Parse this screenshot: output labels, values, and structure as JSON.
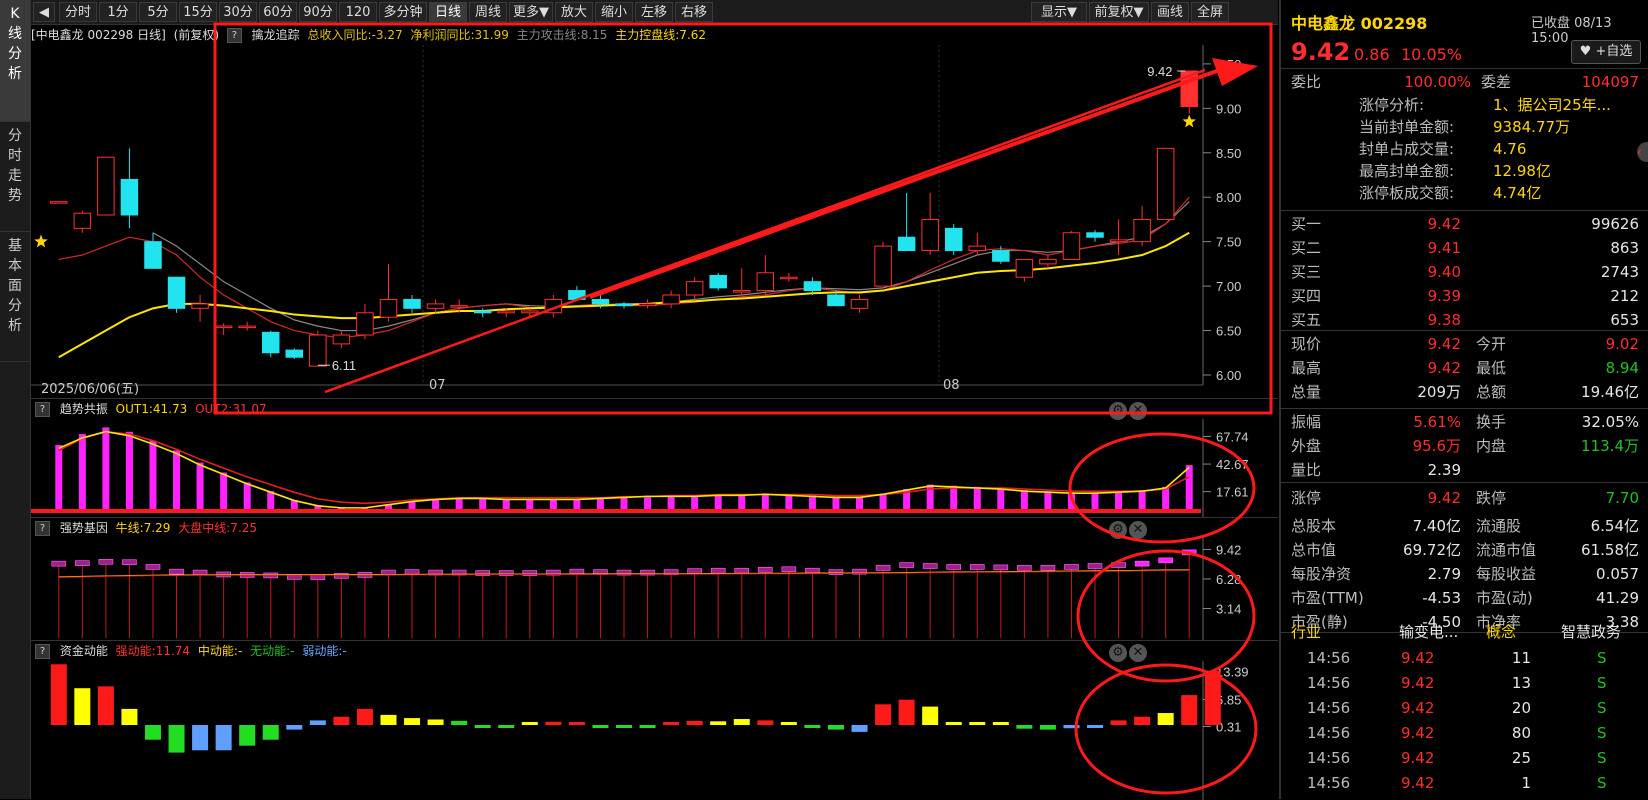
{
  "left_tabs": [
    "K线分析",
    "分时走势",
    "基本面分析"
  ],
  "toolbar": {
    "period_buttons": [
      "分时",
      "1分",
      "5分",
      "15分",
      "30分",
      "60分",
      "90分",
      "120分",
      "多分钟",
      "日线",
      "周线",
      "更多▼",
      "放大",
      "缩小",
      "左移",
      "右移"
    ],
    "right_buttons": [
      "显示▼",
      "前复权▼",
      "画线",
      "全屏"
    ],
    "active": "日线"
  },
  "main_panel": {
    "stock_label": "[中电鑫龙 002298 日线]",
    "fq_label": "(前复权)",
    "indicator_name": "擒龙追踪",
    "indicator_values": [
      "总收入同比:-3.27",
      "净利润同比:31.99",
      "主力攻击线:8.15",
      "主力控盘线:7.62"
    ],
    "y_ticks": [
      "9.50",
      "9.00",
      "8.50",
      "8.00",
      "7.50",
      "7.00",
      "6.50",
      "6.00"
    ],
    "date_label": "2025/06/06(五)",
    "month_labels": [
      "07",
      "08"
    ],
    "high_label": "9.42",
    "low_label": "6.11"
  },
  "panel2": {
    "name": "趋势共振",
    "out1": "OUT1:41.73",
    "out2": "OUT2:31.07",
    "y_ticks": [
      "67.74",
      "42.67",
      "17.61"
    ]
  },
  "panel3": {
    "name": "强势基因",
    "line1": "牛线:7.29",
    "line2": "大盘中线:7.25",
    "y_ticks": [
      "9.42",
      "6.28",
      "3.14"
    ]
  },
  "panel4": {
    "name": "资金动能",
    "strong": "强动能:11.74",
    "mid": "中动能:-",
    "none": "无动能:-",
    "weak": "弱动能:-",
    "y_ticks": [
      "13.39",
      "6.85",
      "0.31"
    ]
  },
  "quote": {
    "name": "中电鑫龙 002298",
    "status": "已收盘 08/13 15:00",
    "price": "9.42",
    "change": "0.86",
    "pct": "10.05%",
    "add_label": "+自选",
    "wb_label": "委比",
    "wb_value": "100.00%",
    "wc_label": "委差",
    "wc_value": "104097",
    "limit_info": [
      {
        "k": "涨停分析:",
        "v": "1、据公司25年..."
      },
      {
        "k": "当前封单金额:",
        "v": "9384.77万"
      },
      {
        "k": "封单占成交量:",
        "v": "4.76"
      },
      {
        "k": "最高封单金额:",
        "v": "12.98亿"
      },
      {
        "k": "涨停板成交额:",
        "v": "4.74亿"
      }
    ],
    "buys": [
      {
        "k": "买一",
        "p": "9.42",
        "v": "99626"
      },
      {
        "k": "买二",
        "p": "9.41",
        "v": "863"
      },
      {
        "k": "买三",
        "p": "9.40",
        "v": "2743"
      },
      {
        "k": "买四",
        "p": "9.39",
        "v": "212"
      },
      {
        "k": "买五",
        "p": "9.38",
        "v": "653"
      }
    ],
    "stats": [
      {
        "k1": "现价",
        "v1": "9.42",
        "k2": "今开",
        "v2": "9.02"
      },
      {
        "k1": "最高",
        "v1": "9.42",
        "k2": "最低",
        "v2": "8.94"
      },
      {
        "k1": "总量",
        "v1": "209万",
        "k2": "总额",
        "v2": "19.46亿"
      },
      {
        "k1": "振幅",
        "v1": "5.61%",
        "k2": "换手",
        "v2": "32.05%"
      },
      {
        "k1": "外盘",
        "v1": "95.6万",
        "k2": "内盘",
        "v2": "113.4万"
      },
      {
        "k1": "量比",
        "v1": "2.39",
        "k2": "",
        "v2": ""
      },
      {
        "k1": "涨停",
        "v1": "9.42",
        "k2": "跌停",
        "v2": "7.70"
      },
      {
        "k1": "总股本",
        "v1": "7.40亿",
        "k2": "流通股",
        "v2": "6.54亿"
      },
      {
        "k1": "总市值",
        "v1": "69.72亿",
        "k2": "流通市值",
        "v2": "61.58亿"
      },
      {
        "k1": "每股净资",
        "v1": "2.79",
        "k2": "每股收益",
        "v2": "0.057"
      },
      {
        "k1": "市盈(TTM)",
        "v1": "-4.53",
        "k2": "市盈(动)",
        "v2": "41.29"
      },
      {
        "k1": "市盈(静)",
        "v1": "-4.50",
        "k2": "市净率",
        "v2": "3.38"
      }
    ],
    "industry": {
      "k1": "行业",
      "v1": "输变电...",
      "k2": "概念",
      "v2": "智慧政务"
    },
    "ticks": [
      {
        "t": "14:56",
        "p": "9.42",
        "v": "11",
        "s": "S"
      },
      {
        "t": "14:56",
        "p": "9.42",
        "v": "13",
        "s": "S"
      },
      {
        "t": "14:56",
        "p": "9.42",
        "v": "20",
        "s": "S"
      },
      {
        "t": "14:56",
        "p": "9.42",
        "v": "80",
        "s": "S"
      },
      {
        "t": "14:56",
        "p": "9.42",
        "v": "25",
        "s": "S"
      },
      {
        "t": "14:56",
        "p": "9.42",
        "v": "1",
        "s": "S"
      }
    ]
  },
  "chart_data": [
    {
      "type": "candlestick",
      "ylim": [
        6.0,
        9.6
      ],
      "candles": [
        [
          7.95,
          7.95,
          7.95,
          7.95
        ],
        [
          7.65,
          7.85,
          7.6,
          7.82
        ],
        [
          7.8,
          8.45,
          7.8,
          8.45
        ],
        [
          8.2,
          8.55,
          7.65,
          7.8
        ],
        [
          7.5,
          7.6,
          7.2,
          7.2
        ],
        [
          7.1,
          7.1,
          6.7,
          6.75
        ],
        [
          6.75,
          6.9,
          6.6,
          6.8
        ],
        [
          6.55,
          6.58,
          6.45,
          6.55
        ],
        [
          6.55,
          6.6,
          6.5,
          6.55
        ],
        [
          6.48,
          6.5,
          6.2,
          6.25
        ],
        [
          6.28,
          6.3,
          6.18,
          6.2
        ],
        [
          6.1,
          6.5,
          6.1,
          6.45
        ],
        [
          6.35,
          6.5,
          6.3,
          6.45
        ],
        [
          6.45,
          6.8,
          6.4,
          6.7
        ],
        [
          6.65,
          7.25,
          6.6,
          6.85
        ],
        [
          6.85,
          6.9,
          6.7,
          6.75
        ],
        [
          6.75,
          6.85,
          6.7,
          6.8
        ],
        [
          6.78,
          6.85,
          6.7,
          6.78
        ],
        [
          6.72,
          6.75,
          6.65,
          6.7
        ],
        [
          6.7,
          6.75,
          6.65,
          6.72
        ],
        [
          6.7,
          6.75,
          6.65,
          6.72
        ],
        [
          6.7,
          6.9,
          6.65,
          6.85
        ],
        [
          6.95,
          7.0,
          6.85,
          6.85
        ],
        [
          6.85,
          6.9,
          6.75,
          6.8
        ],
        [
          6.8,
          6.82,
          6.75,
          6.78
        ],
        [
          6.78,
          6.85,
          6.75,
          6.8
        ],
        [
          6.8,
          6.95,
          6.75,
          6.9
        ],
        [
          6.9,
          7.1,
          6.85,
          7.05
        ],
        [
          7.12,
          7.15,
          6.95,
          6.98
        ],
        [
          6.95,
          7.2,
          6.9,
          6.95
        ],
        [
          6.95,
          7.35,
          6.9,
          7.15
        ],
        [
          7.1,
          7.15,
          7.05,
          7.1
        ],
        [
          7.05,
          7.1,
          6.9,
          6.95
        ],
        [
          6.9,
          6.95,
          6.8,
          6.78
        ],
        [
          6.75,
          6.9,
          6.7,
          6.85
        ],
        [
          7.0,
          7.5,
          7.0,
          7.45
        ],
        [
          7.55,
          8.05,
          7.4,
          7.4
        ],
        [
          7.4,
          8.05,
          7.35,
          7.75
        ],
        [
          7.65,
          7.7,
          7.35,
          7.4
        ],
        [
          7.4,
          7.6,
          7.35,
          7.45
        ],
        [
          7.4,
          7.45,
          7.25,
          7.28
        ],
        [
          7.1,
          7.3,
          7.05,
          7.3
        ],
        [
          7.25,
          7.35,
          7.2,
          7.3
        ],
        [
          7.3,
          7.62,
          7.3,
          7.6
        ],
        [
          7.6,
          7.63,
          7.5,
          7.55
        ],
        [
          7.5,
          7.75,
          7.35,
          7.52
        ],
        [
          7.5,
          7.9,
          7.45,
          7.75
        ],
        [
          7.75,
          8.55,
          7.75,
          8.55
        ],
        [
          9.02,
          9.42,
          8.94,
          9.42
        ]
      ],
      "ma_fast": [
        7.3,
        7.35,
        7.45,
        7.55,
        7.5,
        7.35,
        7.1,
        6.9,
        6.75,
        6.6,
        6.5,
        6.45,
        6.42,
        6.45,
        6.5,
        6.6,
        6.7,
        6.75,
        6.78,
        6.8,
        6.76,
        6.75,
        6.78,
        6.8,
        6.78,
        6.78,
        6.8,
        6.82,
        6.85,
        6.88,
        6.9,
        6.95,
        6.98,
        6.95,
        6.92,
        6.95,
        7.05,
        7.18,
        7.3,
        7.4,
        7.42,
        7.4,
        7.35,
        7.4,
        7.45,
        7.48,
        7.52,
        7.7,
        8.0
      ],
      "ma_slow": [
        6.2,
        6.35,
        6.5,
        6.65,
        6.75,
        6.8,
        6.8,
        6.78,
        6.75,
        6.72,
        6.68,
        6.66,
        6.64,
        6.64,
        6.66,
        6.68,
        6.7,
        6.72,
        6.72,
        6.74,
        6.75,
        6.76,
        6.77,
        6.78,
        6.79,
        6.8,
        6.82,
        6.83,
        6.85,
        6.86,
        6.88,
        6.9,
        6.92,
        6.93,
        6.93,
        6.95,
        7.0,
        7.05,
        7.1,
        7.15,
        7.17,
        7.18,
        7.2,
        7.23,
        7.26,
        7.3,
        7.35,
        7.45,
        7.6
      ],
      "ma_gray": [
        null,
        null,
        null,
        null,
        7.6,
        7.45,
        7.25,
        7.05,
        6.9,
        6.75,
        6.62,
        6.55,
        6.5,
        6.5,
        6.55,
        6.62,
        6.7,
        6.75,
        6.78,
        6.8,
        6.78,
        6.77,
        6.78,
        6.79,
        6.8,
        6.8,
        6.82,
        6.85,
        6.88,
        6.9,
        6.93,
        6.96,
        6.98,
        6.97,
        6.96,
        6.98,
        7.05,
        7.15,
        7.25,
        7.35,
        7.4,
        7.4,
        7.38,
        7.4,
        7.45,
        7.5,
        7.55,
        7.7,
        7.95
      ]
    },
    {
      "type": "bar",
      "ylim": [
        0,
        80
      ],
      "values": [
        60,
        70,
        76,
        72,
        64,
        55,
        44,
        35,
        26,
        18,
        10,
        5,
        3,
        3,
        6,
        9,
        11,
        12,
        12,
        11,
        11,
        11,
        11,
        12,
        13,
        14,
        14,
        14,
        15,
        15,
        16,
        15,
        14,
        13,
        13,
        16,
        20,
        24,
        23,
        22,
        21,
        19,
        18,
        17,
        17,
        18,
        19,
        22,
        41.73
      ],
      "line": [
        55,
        66,
        72,
        70,
        64,
        56,
        47,
        39,
        31,
        24,
        17,
        11,
        8,
        7,
        8,
        10,
        11,
        12,
        12,
        12,
        12,
        12,
        12,
        12,
        13,
        13,
        14,
        14,
        15,
        15,
        15,
        15,
        15,
        14,
        14,
        15,
        17,
        20,
        21,
        21,
        21,
        20,
        19,
        18,
        18,
        18,
        18,
        20,
        31.07
      ]
    },
    {
      "type": "bar",
      "ylim": [
        0,
        10
      ],
      "values": [
        7.75,
        7.8,
        7.95,
        7.9,
        7.4,
        6.9,
        6.8,
        6.6,
        6.55,
        6.5,
        6.35,
        6.3,
        6.45,
        6.55,
        6.8,
        6.85,
        6.8,
        6.8,
        6.75,
        6.75,
        6.75,
        6.8,
        6.9,
        6.85,
        6.8,
        6.8,
        6.85,
        6.95,
        7.0,
        7.0,
        7.1,
        7.15,
        7.0,
        6.85,
        6.9,
        7.3,
        7.6,
        7.5,
        7.4,
        7.4,
        7.35,
        7.3,
        7.3,
        7.4,
        7.5,
        7.6,
        7.75,
        8.1,
        8.95
      ],
      "line": [
        6.5,
        6.55,
        6.6,
        6.65,
        6.68,
        6.7,
        6.72,
        6.73,
        6.74,
        6.74,
        6.74,
        6.75,
        6.75,
        6.75,
        6.76,
        6.77,
        6.78,
        6.78,
        6.79,
        6.8,
        6.8,
        6.8,
        6.81,
        6.82,
        6.83,
        6.83,
        6.84,
        6.85,
        6.86,
        6.87,
        6.88,
        6.89,
        6.9,
        6.91,
        6.92,
        6.94,
        6.97,
        7.0,
        7.02,
        7.04,
        7.06,
        7.08,
        7.1,
        7.12,
        7.15,
        7.17,
        7.2,
        7.23,
        7.25
      ]
    },
    {
      "type": "bar",
      "ylim": [
        0,
        14
      ],
      "values": [
        13.2,
        8.0,
        8.4,
        3.5,
        -3.2,
        -6.0,
        -5.5,
        -5.5,
        -4.5,
        -3.2,
        -1.0,
        1.0,
        1.8,
        3.5,
        2.2,
        1.5,
        1.2,
        0.9,
        -0.5,
        -0.6,
        0.4,
        0.7,
        0.6,
        -0.3,
        -0.4,
        -0.3,
        0.6,
        0.9,
        0.8,
        1.3,
        1.0,
        0.6,
        -0.5,
        -1.0,
        -1.5,
        4.5,
        5.5,
        4.0,
        0.5,
        0.4,
        0.3,
        -0.8,
        -1.0,
        -0.7,
        -0.5,
        1.0,
        1.8,
        2.6,
        6.5,
        11.74
      ],
      "colors": [
        "red",
        "yellow",
        "red",
        "yellow",
        "green",
        "green",
        "blue",
        "blue",
        "green",
        "green",
        "blue",
        "blue",
        "red",
        "red",
        "yellow",
        "yellow",
        "yellow",
        "green",
        "green",
        "green",
        "yellow",
        "red",
        "red",
        "green",
        "green",
        "green",
        "red",
        "red",
        "yellow",
        "yellow",
        "red",
        "yellow",
        "green",
        "green",
        "blue",
        "red",
        "red",
        "yellow",
        "yellow",
        "yellow",
        "yellow",
        "green",
        "green",
        "blue",
        "blue",
        "red",
        "red",
        "yellow",
        "red",
        "red"
      ]
    }
  ]
}
